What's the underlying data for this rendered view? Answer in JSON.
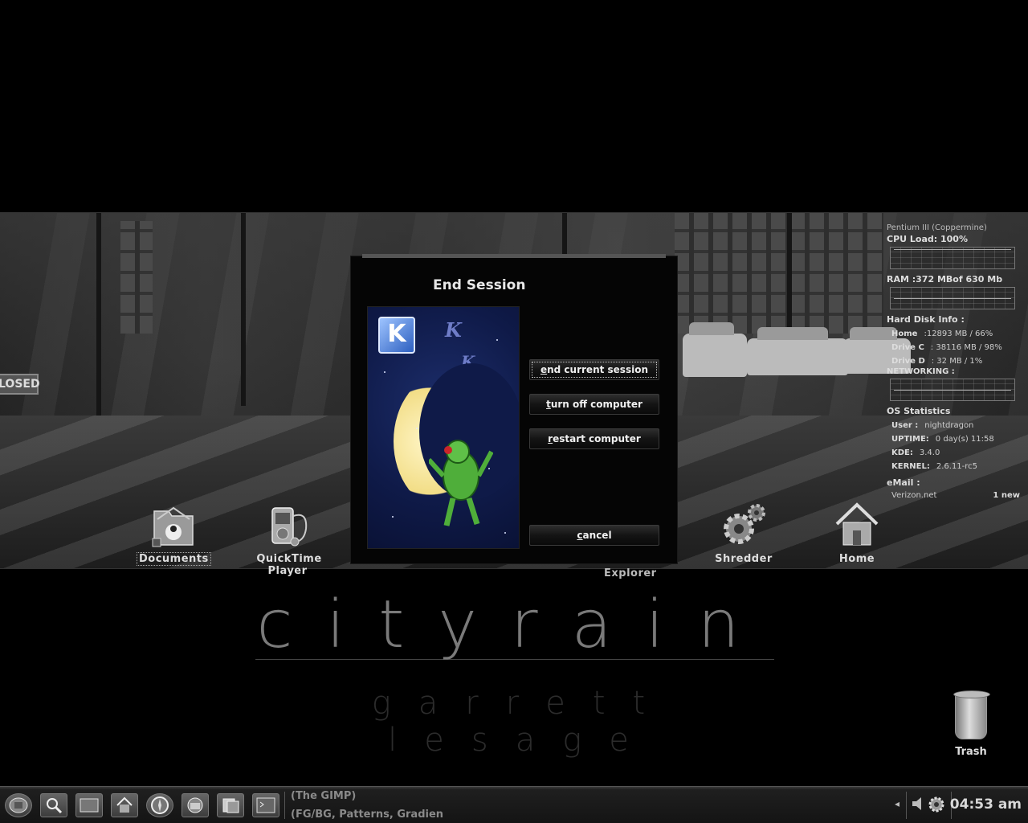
{
  "desktop": {
    "icons": {
      "documents": "Documents",
      "quicktime": "QuickTime Player",
      "shredder": "Shredder",
      "home": "Home",
      "explorer": "Explorer",
      "trash": "Trash"
    },
    "wall_sign": "LOSED",
    "logo": {
      "title": "cityrain",
      "subtitle": "garrett lesage"
    }
  },
  "sysmon": {
    "cpu_name": "Pentium III (Coppermine)",
    "cpu_load": "CPU Load: 100%",
    "ram": "RAM :372 MBof 630 Mb",
    "disk_header": "Hard Disk Info :",
    "disks": [
      {
        "label": "Home",
        "value": ":12893 MB / 66%"
      },
      {
        "label": "Drive C",
        "value": ": 38116 MB / 98%"
      },
      {
        "label": "Drive D",
        "value": ": 32 MB / 1%"
      }
    ],
    "networking": "NETWORKING :",
    "os_header": "OS Statistics",
    "os": [
      {
        "label": "User :",
        "value": "nightdragon"
      },
      {
        "label": "UPTIME:",
        "value": "0 day(s) 11:58"
      },
      {
        "label": "KDE:",
        "value": "3.4.0"
      },
      {
        "label": "KERNEL:",
        "value": "2.6.11-rc5"
      }
    ],
    "email_header": "eMail :",
    "email_account": "Verizon.net",
    "email_count": "1 new"
  },
  "dialog": {
    "title": "End Session",
    "k_badge": "K",
    "buttons": {
      "end_session": {
        "mnemonic": "e",
        "rest": "nd current session"
      },
      "turn_off": {
        "mnemonic": "t",
        "rest": "urn off computer"
      },
      "restart": {
        "mnemonic": "r",
        "rest": "estart computer"
      },
      "cancel": {
        "mnemonic": "c",
        "rest": "ancel"
      }
    }
  },
  "taskbar": {
    "task_line1": "(The GIMP)",
    "task_line2": "(FG/BG, Patterns, Gradien",
    "clock": "04:53 am",
    "colors": {
      "accent": "#1f1f1f",
      "text": "#8a8a8a"
    }
  }
}
